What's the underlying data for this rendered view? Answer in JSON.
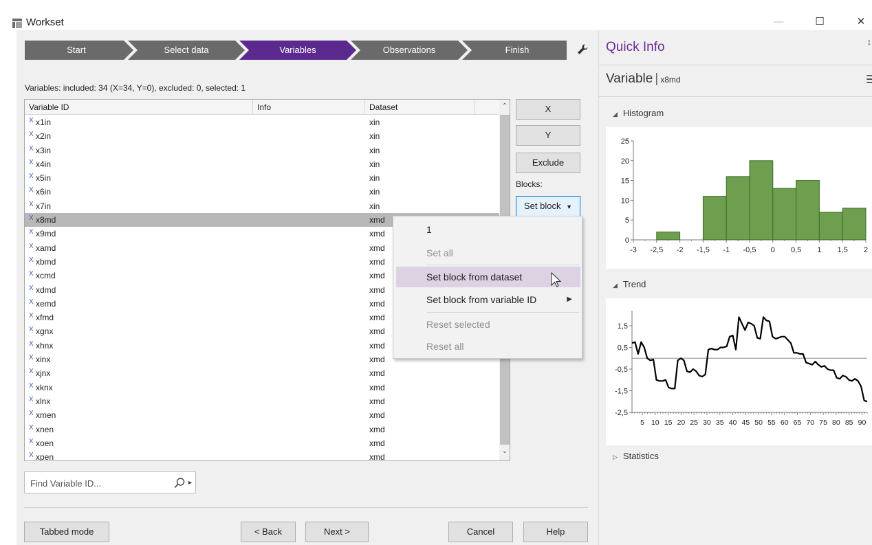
{
  "window": {
    "title": "Workset",
    "minimize": "—",
    "maximize": "☐",
    "close": "✕"
  },
  "wizard": {
    "steps": [
      "Start",
      "Select data",
      "Variables",
      "Observations",
      "Finish"
    ],
    "active_index": 2,
    "active_color": "#5c2a8f",
    "inactive_color": "#6a6a6a"
  },
  "status_line": "Variables: included: 34 (X=34, Y=0), excluded: 0, selected: 1",
  "table": {
    "columns": [
      "Variable ID",
      "Info",
      "Dataset"
    ],
    "x_marker": "X",
    "selected_index": 7,
    "rows": [
      {
        "id": "x1in",
        "info": "",
        "dataset": "xin"
      },
      {
        "id": "x2in",
        "info": "",
        "dataset": "xin"
      },
      {
        "id": "x3in",
        "info": "",
        "dataset": "xin"
      },
      {
        "id": "x4in",
        "info": "",
        "dataset": "xin"
      },
      {
        "id": "x5in",
        "info": "",
        "dataset": "xin"
      },
      {
        "id": "x6in",
        "info": "",
        "dataset": "xin"
      },
      {
        "id": "x7in",
        "info": "",
        "dataset": "xin"
      },
      {
        "id": "x8md",
        "info": "",
        "dataset": "xmd"
      },
      {
        "id": "x9md",
        "info": "",
        "dataset": "xmd"
      },
      {
        "id": "xamd",
        "info": "",
        "dataset": "xmd"
      },
      {
        "id": "xbmd",
        "info": "",
        "dataset": "xmd"
      },
      {
        "id": "xcmd",
        "info": "",
        "dataset": "xmd"
      },
      {
        "id": "xdmd",
        "info": "",
        "dataset": "xmd"
      },
      {
        "id": "xemd",
        "info": "",
        "dataset": "xmd"
      },
      {
        "id": "xfmd",
        "info": "",
        "dataset": "xmd"
      },
      {
        "id": "xgnx",
        "info": "",
        "dataset": "xmd"
      },
      {
        "id": "xhnx",
        "info": "",
        "dataset": "xmd"
      },
      {
        "id": "xinx",
        "info": "",
        "dataset": "xmd"
      },
      {
        "id": "xjnx",
        "info": "",
        "dataset": "xmd"
      },
      {
        "id": "xknx",
        "info": "",
        "dataset": "xmd"
      },
      {
        "id": "xlnx",
        "info": "",
        "dataset": "xmd"
      },
      {
        "id": "xmen",
        "info": "",
        "dataset": "xmd"
      },
      {
        "id": "xnen",
        "info": "",
        "dataset": "xmd"
      },
      {
        "id": "xoen",
        "info": "",
        "dataset": "xmd"
      },
      {
        "id": "xpen",
        "info": "",
        "dataset": "xmd"
      }
    ]
  },
  "side_buttons": {
    "x": "X",
    "y": "Y",
    "exclude": "Exclude",
    "blocks_label": "Blocks:",
    "set_block": "Set block"
  },
  "context_menu": {
    "items": [
      {
        "label": "1",
        "enabled": true
      },
      {
        "label": "Set all",
        "enabled": false
      },
      {
        "label": "Set block from dataset",
        "enabled": true,
        "hover": true
      },
      {
        "label": "Set block from variable ID",
        "enabled": true,
        "submenu": true
      },
      {
        "label": "Reset selected",
        "enabled": false
      },
      {
        "label": "Reset all",
        "enabled": false
      }
    ]
  },
  "find": {
    "placeholder": "Find Variable ID..."
  },
  "bottom_buttons": {
    "tabbed_mode": "Tabbed mode",
    "back": "< Back",
    "next": "Next >",
    "cancel": "Cancel",
    "help": "Help"
  },
  "quick_info": {
    "title": "Quick Info",
    "pin": "↕",
    "variable_label": "Variable",
    "variable_name": "x8md",
    "histogram_label": "Histogram",
    "trend_label": "Trend",
    "statistics_label": "Statistics",
    "title_color": "#6a2c91"
  },
  "chart_data": [
    {
      "type": "bar",
      "title": "Histogram",
      "bar_color": "#6e9f4f",
      "bins": [
        {
          "from": -2.5,
          "to": -2.0,
          "count": 2
        },
        {
          "from": -2.0,
          "to": -1.5,
          "count": 0
        },
        {
          "from": -1.5,
          "to": -1.0,
          "count": 11
        },
        {
          "from": -1.0,
          "to": -0.5,
          "count": 16
        },
        {
          "from": -0.5,
          "to": 0.0,
          "count": 20
        },
        {
          "from": 0.0,
          "to": 0.5,
          "count": 13
        },
        {
          "from": 0.5,
          "to": 1.0,
          "count": 15
        },
        {
          "from": 1.0,
          "to": 1.5,
          "count": 7
        },
        {
          "from": 1.5,
          "to": 2.0,
          "count": 8
        }
      ],
      "xlim": [
        -3,
        2
      ],
      "ylim": [
        0,
        25
      ],
      "x_ticks": [
        -3,
        -2.5,
        -2,
        -1.5,
        -1,
        -0.5,
        0,
        0.5,
        1,
        1.5,
        2
      ],
      "x_tick_labels": [
        "-3",
        "-2,5",
        "-2",
        "-1,5",
        "-1",
        "-0,5",
        "0",
        "0,5",
        "1",
        "1,5",
        "2"
      ],
      "y_ticks": [
        0,
        5,
        10,
        15,
        20,
        25
      ],
      "y_tick_labels": [
        "0",
        "5",
        "10",
        "15",
        "20",
        "25"
      ]
    },
    {
      "type": "line",
      "title": "Trend",
      "line_color": "#000000",
      "xlim": [
        1,
        92
      ],
      "ylim": [
        -2.5,
        2.2
      ],
      "reference_line": 0,
      "x_ticks": [
        5,
        10,
        15,
        20,
        25,
        30,
        35,
        40,
        45,
        50,
        55,
        60,
        65,
        70,
        75,
        80,
        85,
        90
      ],
      "x_tick_labels": [
        "5",
        "10",
        "15",
        "20",
        "25",
        "30",
        "35",
        "40",
        "45",
        "50",
        "55",
        "60",
        "65",
        "70",
        "75",
        "80",
        "85",
        "90"
      ],
      "y_ticks": [
        1.5,
        0.5,
        -0.5,
        -1.5,
        -2.5
      ],
      "y_tick_labels": [
        "1,5",
        "0,5",
        "-0,5",
        "-1,5",
        "-2,5"
      ],
      "values": [
        0.7,
        0.75,
        0.2,
        0.75,
        0.5,
        0.0,
        -0.1,
        -0.05,
        -1.0,
        -1.05,
        -1.05,
        -1.0,
        -1.35,
        -1.4,
        -1.4,
        -0.1,
        0.0,
        -0.1,
        -0.6,
        -0.65,
        -0.5,
        -0.6,
        -0.8,
        -0.85,
        -0.75,
        0.4,
        0.45,
        0.4,
        0.4,
        0.5,
        0.5,
        0.55,
        1.0,
        1.05,
        0.4,
        1.9,
        1.6,
        1.3,
        1.65,
        1.6,
        1.5,
        0.95,
        0.9,
        1.9,
        1.75,
        1.7,
        1.0,
        0.9,
        0.95,
        1.0,
        1.0,
        0.85,
        0.7,
        0.25,
        0.25,
        0.2,
        0.2,
        -0.2,
        -0.25,
        -0.3,
        -0.15,
        -0.3,
        -0.4,
        -0.35,
        -0.5,
        -0.55,
        -0.55,
        -0.9,
        -0.95,
        -0.8,
        -0.85,
        -1.0,
        -1.05,
        -0.95,
        -1.05,
        -1.3,
        -1.95,
        -2.0
      ]
    }
  ]
}
